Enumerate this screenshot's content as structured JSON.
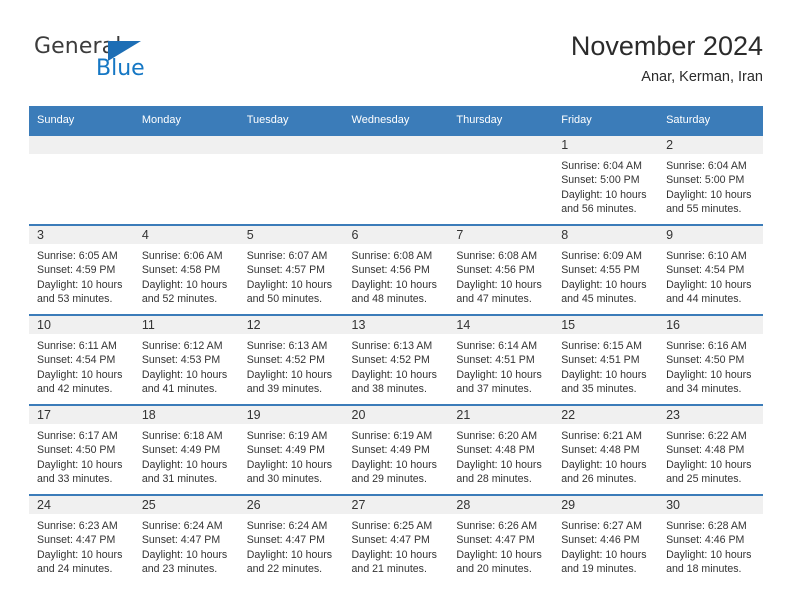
{
  "logo": {
    "text_primary": "General",
    "text_secondary": "Blue",
    "flag_icon": "triangle-flag-icon"
  },
  "header": {
    "title": "November 2024",
    "subtitle": "Anar, Kerman, Iran"
  },
  "calendar": {
    "weekday_headers": [
      "Sunday",
      "Monday",
      "Tuesday",
      "Wednesday",
      "Thursday",
      "Friday",
      "Saturday"
    ],
    "colors": {
      "header_blue": "#3b7cb9",
      "daynum_band": "#f0f0f0",
      "text": "#333333",
      "logo_blue": "#1577c4"
    },
    "weeks": [
      [
        {
          "day": "",
          "sunrise": "",
          "sunset": "",
          "daylight_line1": "",
          "daylight_line2": ""
        },
        {
          "day": "",
          "sunrise": "",
          "sunset": "",
          "daylight_line1": "",
          "daylight_line2": ""
        },
        {
          "day": "",
          "sunrise": "",
          "sunset": "",
          "daylight_line1": "",
          "daylight_line2": ""
        },
        {
          "day": "",
          "sunrise": "",
          "sunset": "",
          "daylight_line1": "",
          "daylight_line2": ""
        },
        {
          "day": "",
          "sunrise": "",
          "sunset": "",
          "daylight_line1": "",
          "daylight_line2": ""
        },
        {
          "day": "1",
          "sunrise": "Sunrise: 6:04 AM",
          "sunset": "Sunset: 5:00 PM",
          "daylight_line1": "Daylight: 10 hours",
          "daylight_line2": "and 56 minutes."
        },
        {
          "day": "2",
          "sunrise": "Sunrise: 6:04 AM",
          "sunset": "Sunset: 5:00 PM",
          "daylight_line1": "Daylight: 10 hours",
          "daylight_line2": "and 55 minutes."
        }
      ],
      [
        {
          "day": "3",
          "sunrise": "Sunrise: 6:05 AM",
          "sunset": "Sunset: 4:59 PM",
          "daylight_line1": "Daylight: 10 hours",
          "daylight_line2": "and 53 minutes."
        },
        {
          "day": "4",
          "sunrise": "Sunrise: 6:06 AM",
          "sunset": "Sunset: 4:58 PM",
          "daylight_line1": "Daylight: 10 hours",
          "daylight_line2": "and 52 minutes."
        },
        {
          "day": "5",
          "sunrise": "Sunrise: 6:07 AM",
          "sunset": "Sunset: 4:57 PM",
          "daylight_line1": "Daylight: 10 hours",
          "daylight_line2": "and 50 minutes."
        },
        {
          "day": "6",
          "sunrise": "Sunrise: 6:08 AM",
          "sunset": "Sunset: 4:56 PM",
          "daylight_line1": "Daylight: 10 hours",
          "daylight_line2": "and 48 minutes."
        },
        {
          "day": "7",
          "sunrise": "Sunrise: 6:08 AM",
          "sunset": "Sunset: 4:56 PM",
          "daylight_line1": "Daylight: 10 hours",
          "daylight_line2": "and 47 minutes."
        },
        {
          "day": "8",
          "sunrise": "Sunrise: 6:09 AM",
          "sunset": "Sunset: 4:55 PM",
          "daylight_line1": "Daylight: 10 hours",
          "daylight_line2": "and 45 minutes."
        },
        {
          "day": "9",
          "sunrise": "Sunrise: 6:10 AM",
          "sunset": "Sunset: 4:54 PM",
          "daylight_line1": "Daylight: 10 hours",
          "daylight_line2": "and 44 minutes."
        }
      ],
      [
        {
          "day": "10",
          "sunrise": "Sunrise: 6:11 AM",
          "sunset": "Sunset: 4:54 PM",
          "daylight_line1": "Daylight: 10 hours",
          "daylight_line2": "and 42 minutes."
        },
        {
          "day": "11",
          "sunrise": "Sunrise: 6:12 AM",
          "sunset": "Sunset: 4:53 PM",
          "daylight_line1": "Daylight: 10 hours",
          "daylight_line2": "and 41 minutes."
        },
        {
          "day": "12",
          "sunrise": "Sunrise: 6:13 AM",
          "sunset": "Sunset: 4:52 PM",
          "daylight_line1": "Daylight: 10 hours",
          "daylight_line2": "and 39 minutes."
        },
        {
          "day": "13",
          "sunrise": "Sunrise: 6:13 AM",
          "sunset": "Sunset: 4:52 PM",
          "daylight_line1": "Daylight: 10 hours",
          "daylight_line2": "and 38 minutes."
        },
        {
          "day": "14",
          "sunrise": "Sunrise: 6:14 AM",
          "sunset": "Sunset: 4:51 PM",
          "daylight_line1": "Daylight: 10 hours",
          "daylight_line2": "and 37 minutes."
        },
        {
          "day": "15",
          "sunrise": "Sunrise: 6:15 AM",
          "sunset": "Sunset: 4:51 PM",
          "daylight_line1": "Daylight: 10 hours",
          "daylight_line2": "and 35 minutes."
        },
        {
          "day": "16",
          "sunrise": "Sunrise: 6:16 AM",
          "sunset": "Sunset: 4:50 PM",
          "daylight_line1": "Daylight: 10 hours",
          "daylight_line2": "and 34 minutes."
        }
      ],
      [
        {
          "day": "17",
          "sunrise": "Sunrise: 6:17 AM",
          "sunset": "Sunset: 4:50 PM",
          "daylight_line1": "Daylight: 10 hours",
          "daylight_line2": "and 33 minutes."
        },
        {
          "day": "18",
          "sunrise": "Sunrise: 6:18 AM",
          "sunset": "Sunset: 4:49 PM",
          "daylight_line1": "Daylight: 10 hours",
          "daylight_line2": "and 31 minutes."
        },
        {
          "day": "19",
          "sunrise": "Sunrise: 6:19 AM",
          "sunset": "Sunset: 4:49 PM",
          "daylight_line1": "Daylight: 10 hours",
          "daylight_line2": "and 30 minutes."
        },
        {
          "day": "20",
          "sunrise": "Sunrise: 6:19 AM",
          "sunset": "Sunset: 4:49 PM",
          "daylight_line1": "Daylight: 10 hours",
          "daylight_line2": "and 29 minutes."
        },
        {
          "day": "21",
          "sunrise": "Sunrise: 6:20 AM",
          "sunset": "Sunset: 4:48 PM",
          "daylight_line1": "Daylight: 10 hours",
          "daylight_line2": "and 28 minutes."
        },
        {
          "day": "22",
          "sunrise": "Sunrise: 6:21 AM",
          "sunset": "Sunset: 4:48 PM",
          "daylight_line1": "Daylight: 10 hours",
          "daylight_line2": "and 26 minutes."
        },
        {
          "day": "23",
          "sunrise": "Sunrise: 6:22 AM",
          "sunset": "Sunset: 4:48 PM",
          "daylight_line1": "Daylight: 10 hours",
          "daylight_line2": "and 25 minutes."
        }
      ],
      [
        {
          "day": "24",
          "sunrise": "Sunrise: 6:23 AM",
          "sunset": "Sunset: 4:47 PM",
          "daylight_line1": "Daylight: 10 hours",
          "daylight_line2": "and 24 minutes."
        },
        {
          "day": "25",
          "sunrise": "Sunrise: 6:24 AM",
          "sunset": "Sunset: 4:47 PM",
          "daylight_line1": "Daylight: 10 hours",
          "daylight_line2": "and 23 minutes."
        },
        {
          "day": "26",
          "sunrise": "Sunrise: 6:24 AM",
          "sunset": "Sunset: 4:47 PM",
          "daylight_line1": "Daylight: 10 hours",
          "daylight_line2": "and 22 minutes."
        },
        {
          "day": "27",
          "sunrise": "Sunrise: 6:25 AM",
          "sunset": "Sunset: 4:47 PM",
          "daylight_line1": "Daylight: 10 hours",
          "daylight_line2": "and 21 minutes."
        },
        {
          "day": "28",
          "sunrise": "Sunrise: 6:26 AM",
          "sunset": "Sunset: 4:47 PM",
          "daylight_line1": "Daylight: 10 hours",
          "daylight_line2": "and 20 minutes."
        },
        {
          "day": "29",
          "sunrise": "Sunrise: 6:27 AM",
          "sunset": "Sunset: 4:46 PM",
          "daylight_line1": "Daylight: 10 hours",
          "daylight_line2": "and 19 minutes."
        },
        {
          "day": "30",
          "sunrise": "Sunrise: 6:28 AM",
          "sunset": "Sunset: 4:46 PM",
          "daylight_line1": "Daylight: 10 hours",
          "daylight_line2": "and 18 minutes."
        }
      ]
    ]
  }
}
